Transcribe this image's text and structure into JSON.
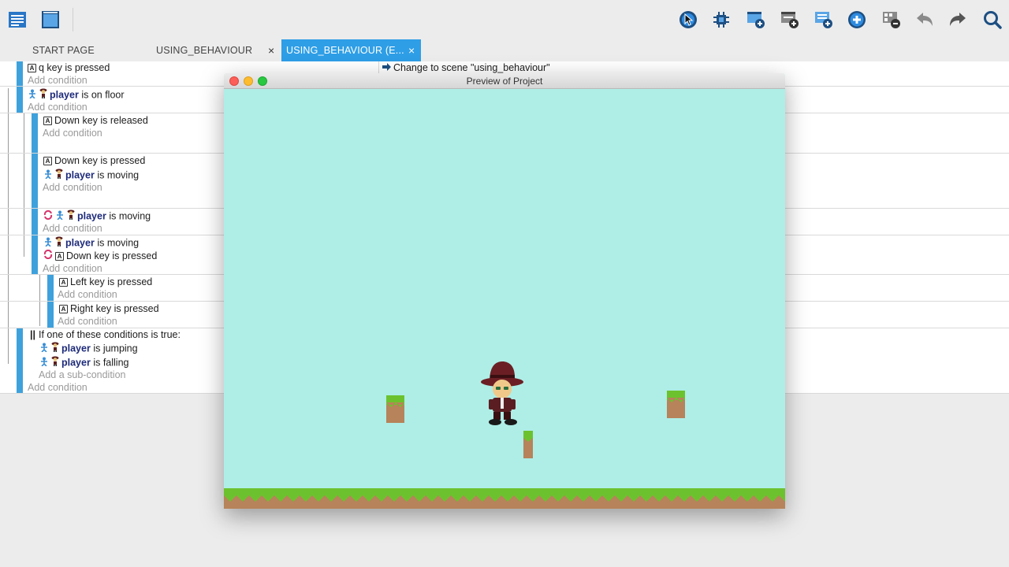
{
  "toolbar": {
    "icons": [
      "project-manager-icon",
      "scene-editor-icon",
      "preview-play-icon",
      "debugger-icon",
      "add-event-icon",
      "add-subevent-icon",
      "add-condition-event-icon",
      "add-icon",
      "delete-event-icon",
      "undo-icon",
      "redo-icon",
      "search-icon"
    ]
  },
  "tabs": [
    {
      "label": "START PAGE"
    },
    {
      "label": "USING_BEHAVIOUR"
    },
    {
      "label": "USING_BEHAVIOUR (E..."
    }
  ],
  "tab_close_glyph": "×",
  "events": {
    "e1": {
      "key_letter": "A",
      "cond_a": "q",
      "cond_b": " key is pressed",
      "add": "Add condition",
      "action": "Change to scene \"using_behaviour\""
    },
    "e2": {
      "obj": "player",
      "cond": " is on floor",
      "add": "Add condition"
    },
    "e3": {
      "key_letter": "A",
      "cond_a": "Down",
      "cond_b": " key is released",
      "add": "Add condition"
    },
    "e4": {
      "key_letter": "A",
      "c1a": "Down",
      "c1b": " key is pressed",
      "obj": "player",
      "c2": " is moving",
      "add": "Add condition"
    },
    "e5": {
      "obj": "player",
      "cond": " is moving",
      "add": "Add condition"
    },
    "e6": {
      "obj": "player",
      "c1": " is moving",
      "key_letter": "A",
      "c2a": "Down",
      "c2b": " key is pressed",
      "add": "Add condition"
    },
    "e7": {
      "key_letter": "A",
      "cond_a": "Left",
      "cond_b": " key is pressed",
      "add": "Add condition"
    },
    "e8": {
      "key_letter": "A",
      "cond_a": "Right",
      "cond_b": " key is pressed",
      "add": "Add condition"
    },
    "e9": {
      "or_glyph": "||",
      "header": "If one of these conditions is true:",
      "obj": "player",
      "c1": " is jumping",
      "c2": " is falling",
      "sub_add": "Add a sub-condition",
      "add": "Add condition"
    }
  },
  "preview": {
    "title": "Preview of Project",
    "colors": {
      "sky": "#aeeee7",
      "grass": "#6cc22e",
      "dirt": "#b7835a"
    }
  }
}
